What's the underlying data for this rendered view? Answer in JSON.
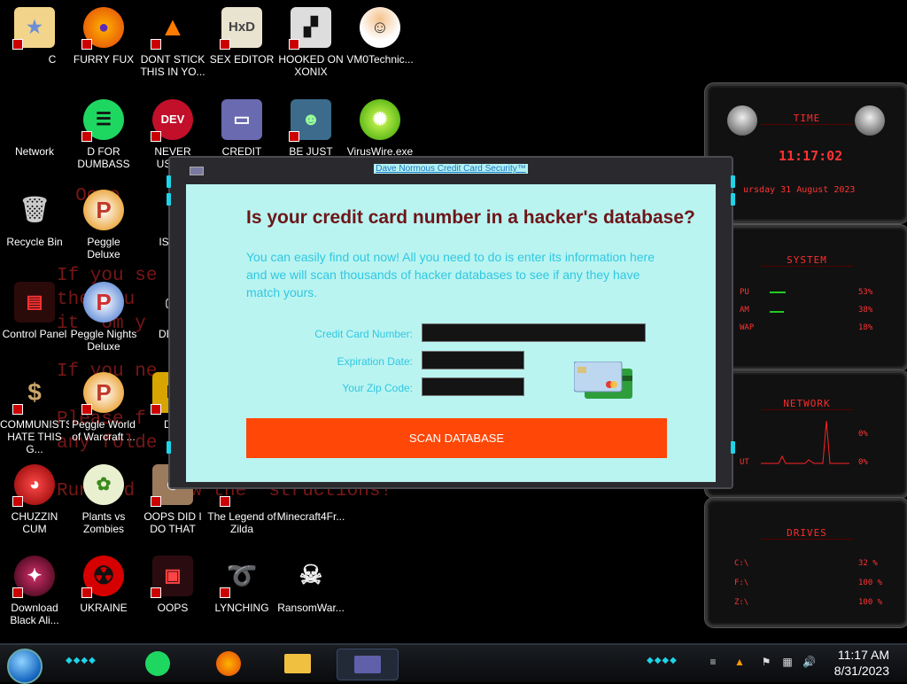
{
  "wallpaper": {
    "lines": [
      "  Oooo",
      "If you se",
      "the you",
      "it  om y",
      "If you ne",
      "Please f",
      "any folde",
      "Run and  llow the  structions!"
    ]
  },
  "desktop_icons": [
    {
      "label": "C",
      "icon": "star-character-icon"
    },
    {
      "label": "FURRY FUX",
      "icon": "firefox-icon"
    },
    {
      "label": "DONT STICK THIS IN YO...",
      "icon": "traffic-cone-icon"
    },
    {
      "label": "SEX EDITOR",
      "icon": "hxd-icon"
    },
    {
      "label": "HOOKED ON XONIX",
      "icon": "xonix-icon"
    },
    {
      "label": "VM0Technic...",
      "icon": "doctor-icon"
    },
    {
      "label": "Network",
      "icon": "network-icon"
    },
    {
      "label": "D FOR DUMBASS",
      "icon": "green-speech-icon"
    },
    {
      "label": "NEVER USED!",
      "icon": "devcpp-icon"
    },
    {
      "label": "CREDIT CARD",
      "icon": "credit-card-icon"
    },
    {
      "label": "BE JUST LIKE",
      "icon": "elf-icon"
    },
    {
      "label": "VirusWire.exe",
      "icon": "lime-icon"
    },
    {
      "label": "Recycle Bin",
      "icon": "recycle-bin-icon"
    },
    {
      "label": "Peggle Deluxe",
      "icon": "peggle-icon"
    },
    {
      "label": "ISRAI",
      "icon": "unknown-icon"
    },
    {
      "label": "Control Panel",
      "icon": "control-panel-icon"
    },
    {
      "label": "Peggle Nights Deluxe",
      "icon": "peggle-nights-icon"
    },
    {
      "label": "DEEZ",
      "icon": "printer-icon"
    },
    {
      "label": "COMMUNISTS HATE THIS G...",
      "icon": "money-bag-icon"
    },
    {
      "label": "Peggle World of Warcraft ...",
      "icon": "peggle-wow-icon"
    },
    {
      "label": "DIE",
      "icon": "yellow-d-icon"
    },
    {
      "label": "CHUZZIN CUM",
      "icon": "chuzzle-icon"
    },
    {
      "label": "Plants vs Zombies",
      "icon": "pvz-icon"
    },
    {
      "label": "OOPS DID I DO THAT",
      "icon": "portrait-icon"
    },
    {
      "label": "The Legend of Zilda",
      "icon": "zelda-icon"
    },
    {
      "label": "Minecraft4Fr...",
      "icon": "minecraft-icon"
    },
    {
      "label": "Download Black Ali...",
      "icon": "black-alien-icon"
    },
    {
      "label": "UKRAINE",
      "icon": "radiation-icon"
    },
    {
      "label": "OOPS",
      "icon": "monitor-icon"
    },
    {
      "label": "LYNCHING",
      "icon": "rope-icon"
    },
    {
      "label": "RansomWar...",
      "icon": "skull-icon"
    }
  ],
  "dialog": {
    "title": "Dave Normous Credit Card Security™",
    "heading": "Is your credit card number in a hacker's database?",
    "description": "You can easily find out now! All you need to do is enter its information here and we will scan thousands of hacker databases to see if any they have match yours.",
    "fields": {
      "card_number_label": "Credit Card Number:",
      "card_number_value": "",
      "expiration_label": "Expiration Date:",
      "expiration_value": "",
      "zip_label": "Your Zip Code:",
      "zip_value": ""
    },
    "scan_button": "SCAN DATABASE",
    "colors": {
      "accent": "#ff4708",
      "content_bg": "#b9f4f1",
      "heading": "#6e1518",
      "text": "#31c7e0"
    }
  },
  "widgets": {
    "time": {
      "title": "TIME",
      "time": "11:17:02",
      "date": "ursday 31 August 2023"
    },
    "system": {
      "title": "SYSTEM",
      "rows": [
        {
          "name": "PU",
          "value": "53%"
        },
        {
          "name": "AM",
          "value": "38%"
        },
        {
          "name": "WAP",
          "value": "18%"
        }
      ]
    },
    "network": {
      "title": "NETWORK",
      "rows": [
        {
          "name": "",
          "value": "0%"
        },
        {
          "name": "UT",
          "value": "0%"
        }
      ]
    },
    "drives": {
      "title": "DRIVES",
      "rows": [
        {
          "name": "C:\\",
          "value": "32 %"
        },
        {
          "name": "F:\\",
          "value": "100 %"
        },
        {
          "name": "Z:\\",
          "value": "100 %"
        }
      ]
    }
  },
  "taskbar": {
    "pinned": [
      {
        "icon": "green-speech-icon"
      },
      {
        "icon": "firefox-icon"
      },
      {
        "icon": "file-explorer-icon"
      },
      {
        "icon": "credit-card-icon"
      }
    ],
    "tray": {
      "time": "11:17 AM",
      "date": "8/31/2023"
    }
  }
}
